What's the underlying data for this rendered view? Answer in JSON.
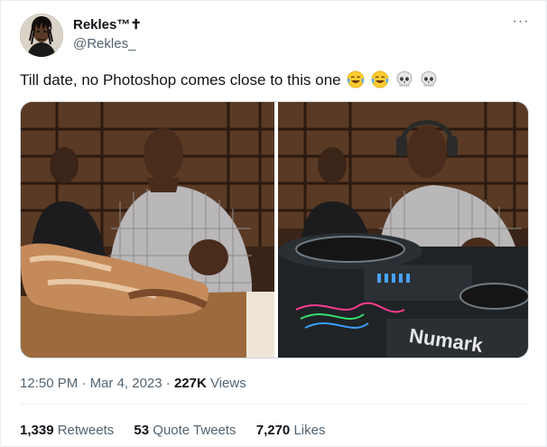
{
  "author": {
    "display_name": "Rekles™✝",
    "handle": "@Rekles_"
  },
  "tweet": {
    "text": "Till date, no Photoshop comes close to this one",
    "emojis": [
      "face-with-tears-of-joy",
      "face-with-tears-of-joy",
      "skull",
      "skull"
    ]
  },
  "media": {
    "left_alt": "Man carving roasted meat on a wooden board",
    "right_alt": "Same man edited as a DJ wearing headphones at a Numark turntable deck",
    "deck_brand": "Numark"
  },
  "meta": {
    "time": "12:50 PM",
    "sep1": "·",
    "date": "Mar 4, 2023",
    "sep2": "·",
    "views_count": "227K",
    "views_label": "Views"
  },
  "stats": {
    "retweets_count": "1,339",
    "retweets_label": "Retweets",
    "quotes_count": "53",
    "quotes_label": "Quote Tweets",
    "likes_count": "7,270",
    "likes_label": "Likes"
  },
  "colors": {
    "text_primary": "#0f1419",
    "text_secondary": "#536471",
    "border": "#cfd9de"
  }
}
